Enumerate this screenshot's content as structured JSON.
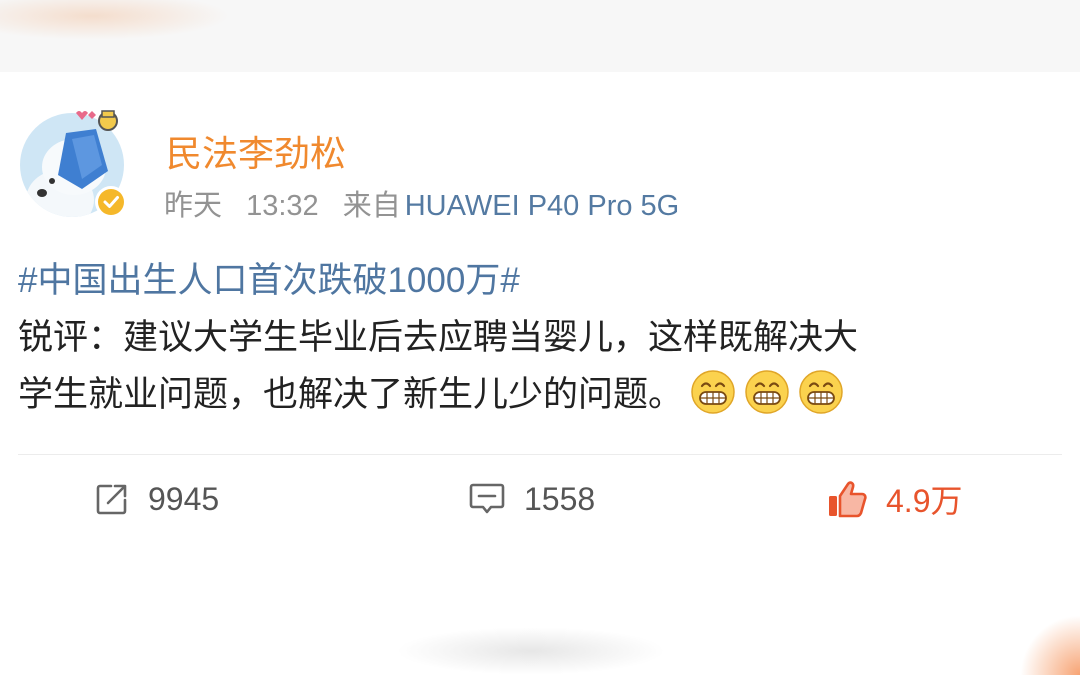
{
  "user": {
    "name": "民法李劲松",
    "avatar_icon": "polar-bear-avatar-icon",
    "verified_icon": "verified-badge-icon"
  },
  "meta": {
    "day": "昨天",
    "time": "13:32",
    "from_label": "来自",
    "device": "HUAWEI P40 Pro 5G"
  },
  "post": {
    "hashtag": "#中国出生人口首次跌破1000万#",
    "line1": "锐评：建议大学生毕业后去应聘当婴儿，这样既解决大",
    "line2": "学生就业问题，也解决了新生儿少的问题。",
    "emoji_icon": "grin-emoji-icon"
  },
  "actions": {
    "repost_count": "9945",
    "comment_count": "1558",
    "like_count": "4.9万",
    "repost_icon": "repost-icon",
    "comment_icon": "comment-icon",
    "like_icon": "thumbs-up-icon"
  },
  "colors": {
    "username": "#f0892e",
    "hashtag": "#4f76a1",
    "device": "#547aa2",
    "like": "#e8542c",
    "verified": "#f5b82a"
  }
}
